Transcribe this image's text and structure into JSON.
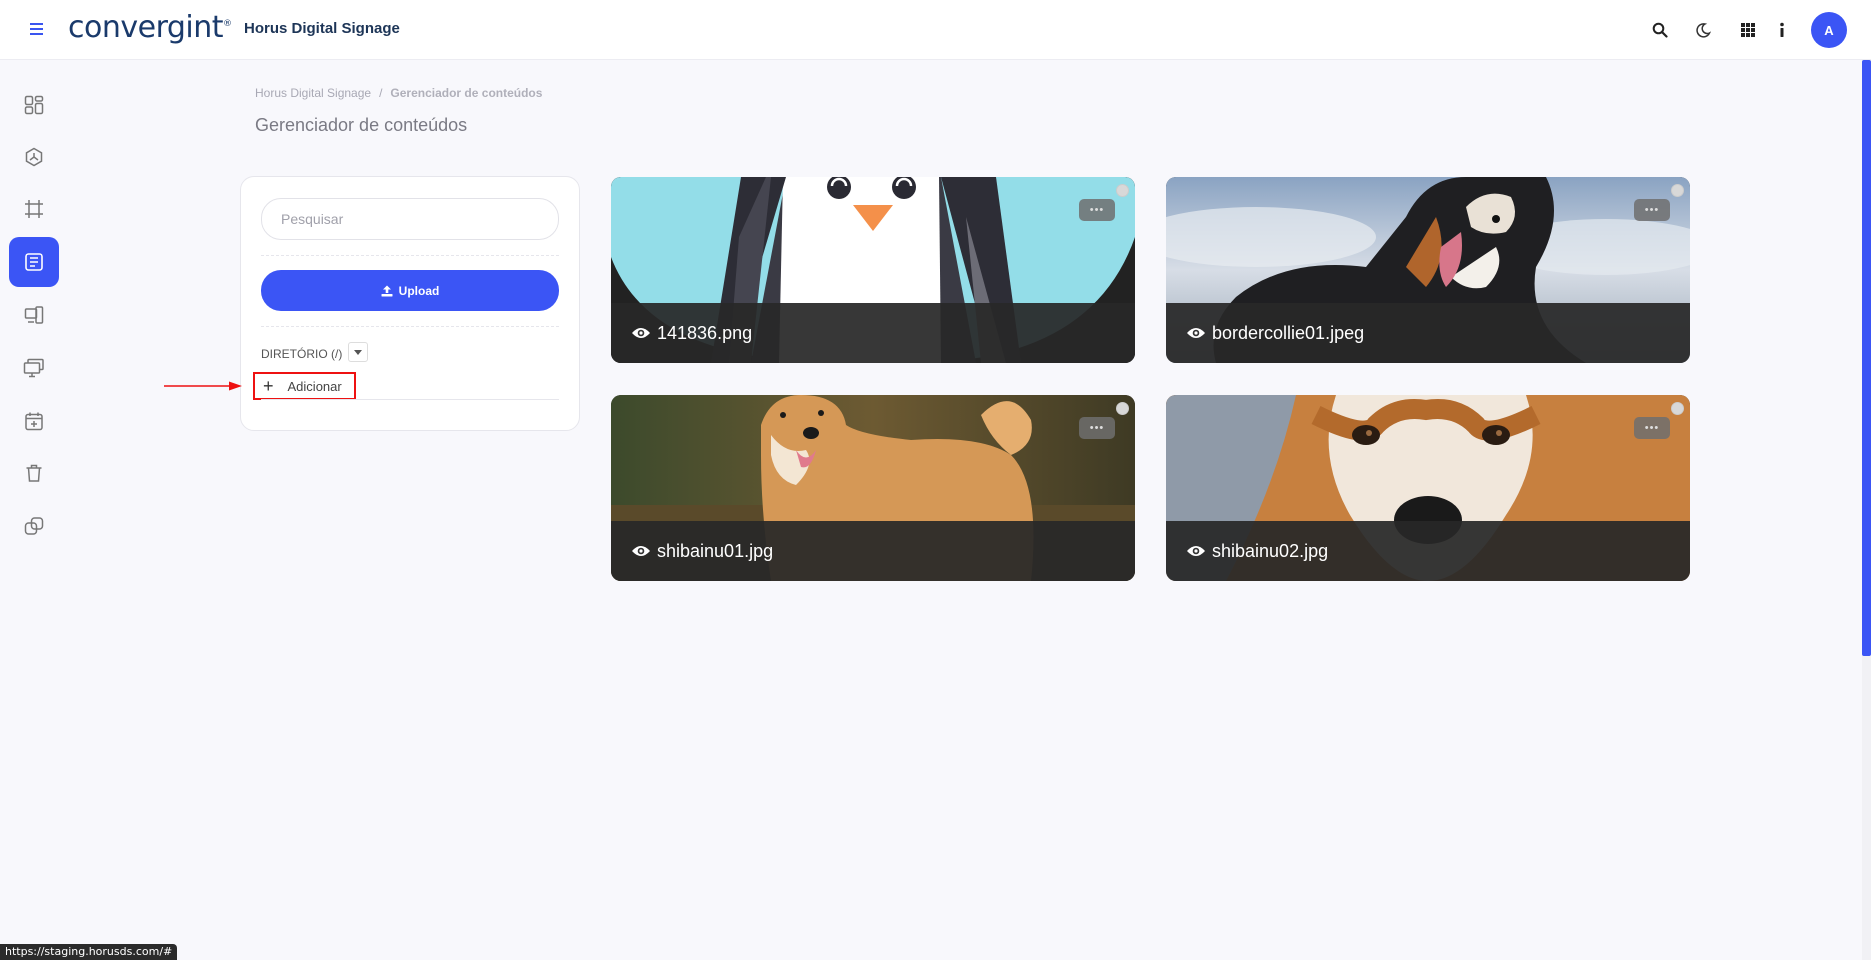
{
  "header": {
    "logo": "convergint",
    "logo_tm": "®",
    "app_title": "Horus Digital Signage",
    "avatar_initial": "A",
    "icons": [
      "search-icon",
      "moon-icon",
      "apps-grid-icon",
      "info-icon"
    ]
  },
  "sidebar": {
    "items": [
      {
        "icon": "dashboard-icon"
      },
      {
        "icon": "hexagon-network-icon"
      },
      {
        "icon": "frame-grid-icon"
      },
      {
        "icon": "content-manager-icon",
        "active": true
      },
      {
        "icon": "devices-icon"
      },
      {
        "icon": "monitors-icon"
      },
      {
        "icon": "calendar-add-icon"
      },
      {
        "icon": "trash-icon"
      },
      {
        "icon": "link-copy-icon"
      }
    ]
  },
  "breadcrumb": {
    "root": "Horus Digital Signage",
    "separator": "/",
    "current": "Gerenciador de conteúdos"
  },
  "page_title": "Gerenciador de conteúdos",
  "panel": {
    "search_placeholder": "Pesquisar",
    "upload_label": "Upload",
    "directory_label": "DIRETÓRIO (/)",
    "add_label": "Adicionar"
  },
  "files": [
    {
      "name": "141836.png"
    },
    {
      "name": "bordercollie01.jpeg"
    },
    {
      "name": "shibainu01.jpg"
    },
    {
      "name": "shibainu02.jpg"
    }
  ],
  "more_label": "•••",
  "status_url": "https://staging.horusds.com/#",
  "colors": {
    "accent": "#3b55f5",
    "annotation": "#e11111"
  }
}
